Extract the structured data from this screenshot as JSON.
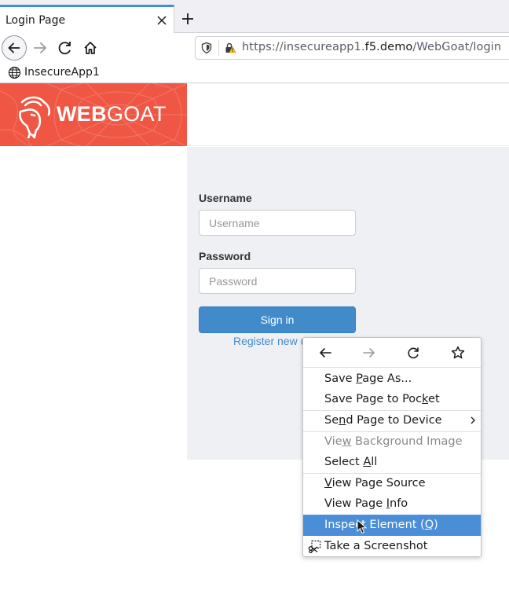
{
  "browser": {
    "tab_title": "Login Page",
    "url_prefix": "https://insecureapp1.",
    "url_domain": "f5.demo",
    "url_path": "/WebGoat/login",
    "bookmark_label": "InsecureApp1"
  },
  "header": {
    "brand_bold": "WEB",
    "brand_light": "GOAT",
    "brand_color": "#ef5744"
  },
  "login": {
    "username_label": "Username",
    "username_placeholder": "Username",
    "password_label": "Password",
    "password_placeholder": "Password",
    "signin_label": "Sign in",
    "register_label": "Register new u",
    "button_color": "#428bca"
  },
  "context_menu": {
    "nav_icons": [
      "back-arrow-icon",
      "forward-arrow-icon",
      "reload-icon",
      "bookmark-star-icon"
    ],
    "items": [
      {
        "pre": "Save ",
        "key": "P",
        "post": "age As..."
      },
      {
        "pre": "Save Page to Poc",
        "key": "k",
        "post": "et"
      },
      {
        "pre": "Se",
        "key": "n",
        "post": "d Page to Device"
      },
      {
        "pre": "Vie",
        "key": "w",
        "post": " Background Image"
      },
      {
        "pre": "Select ",
        "key": "A",
        "post": "ll"
      },
      {
        "pre": "",
        "key": "V",
        "post": "iew Page Source"
      },
      {
        "pre": "View Page ",
        "key": "I",
        "post": "nfo"
      },
      {
        "pre": "Inspect Element (",
        "key": "Q",
        "post": ")"
      },
      {
        "pre": "Take a Screenshot",
        "key": "",
        "post": ""
      }
    ],
    "highlight_color": "#4a8ed8"
  }
}
